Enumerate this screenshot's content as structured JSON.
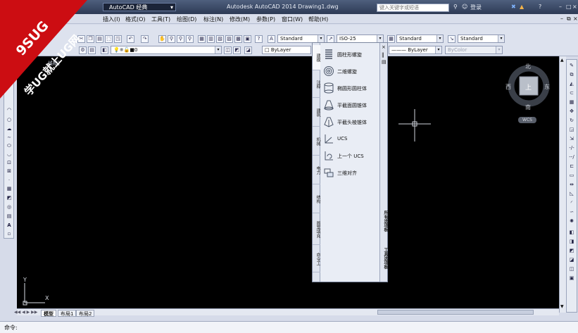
{
  "titlebar": {
    "workspace": "AutoCAD 经典",
    "title": "Autodesk AutoCAD 2014   Drawing1.dwg",
    "search_placeholder": "键入关键字或短语",
    "login": "登录",
    "help": "?"
  },
  "menus": [
    "插入(I)",
    "格式(O)",
    "工具(T)",
    "绘图(D)",
    "标注(N)",
    "修改(M)",
    "参数(P)",
    "窗口(W)",
    "帮助(H)"
  ],
  "styles": {
    "text_style": "Standard",
    "dim_style": "ISO-25",
    "table_style": "Standard",
    "mleader_style": "Standard"
  },
  "layers": {
    "layer": "0",
    "color": "ByLayer",
    "linetype": "ByLayer",
    "color2": "ByColor"
  },
  "canvas": {
    "view_label": "线框]"
  },
  "palette": {
    "tabs": [
      "建模",
      "注释",
      "建筑",
      "机械",
      "电力",
      "结构",
      "图案填充",
      "命令工"
    ],
    "side_labels": [
      "所有选项板",
      "工具选项板"
    ],
    "items": [
      {
        "label": "圆柱形螺旋"
      },
      {
        "label": "二维螺旋"
      },
      {
        "label": "椭圆形圆柱体"
      },
      {
        "label": "平截面圆锥体"
      },
      {
        "label": "平截头棱锥体"
      },
      {
        "label": "UCS"
      },
      {
        "label": "上一个 UCS"
      },
      {
        "label": "三维对齐"
      }
    ]
  },
  "viewcube": {
    "north": "北",
    "south": "南",
    "east": "东",
    "west": "西",
    "top": "上",
    "wcs": "WCS"
  },
  "layout_tabs": [
    "模型",
    "布局1",
    "布局2"
  ],
  "command": {
    "prompt": "命令:"
  },
  "watermark": {
    "line1": "9SUG",
    "line2": "学UG就上UG网"
  }
}
